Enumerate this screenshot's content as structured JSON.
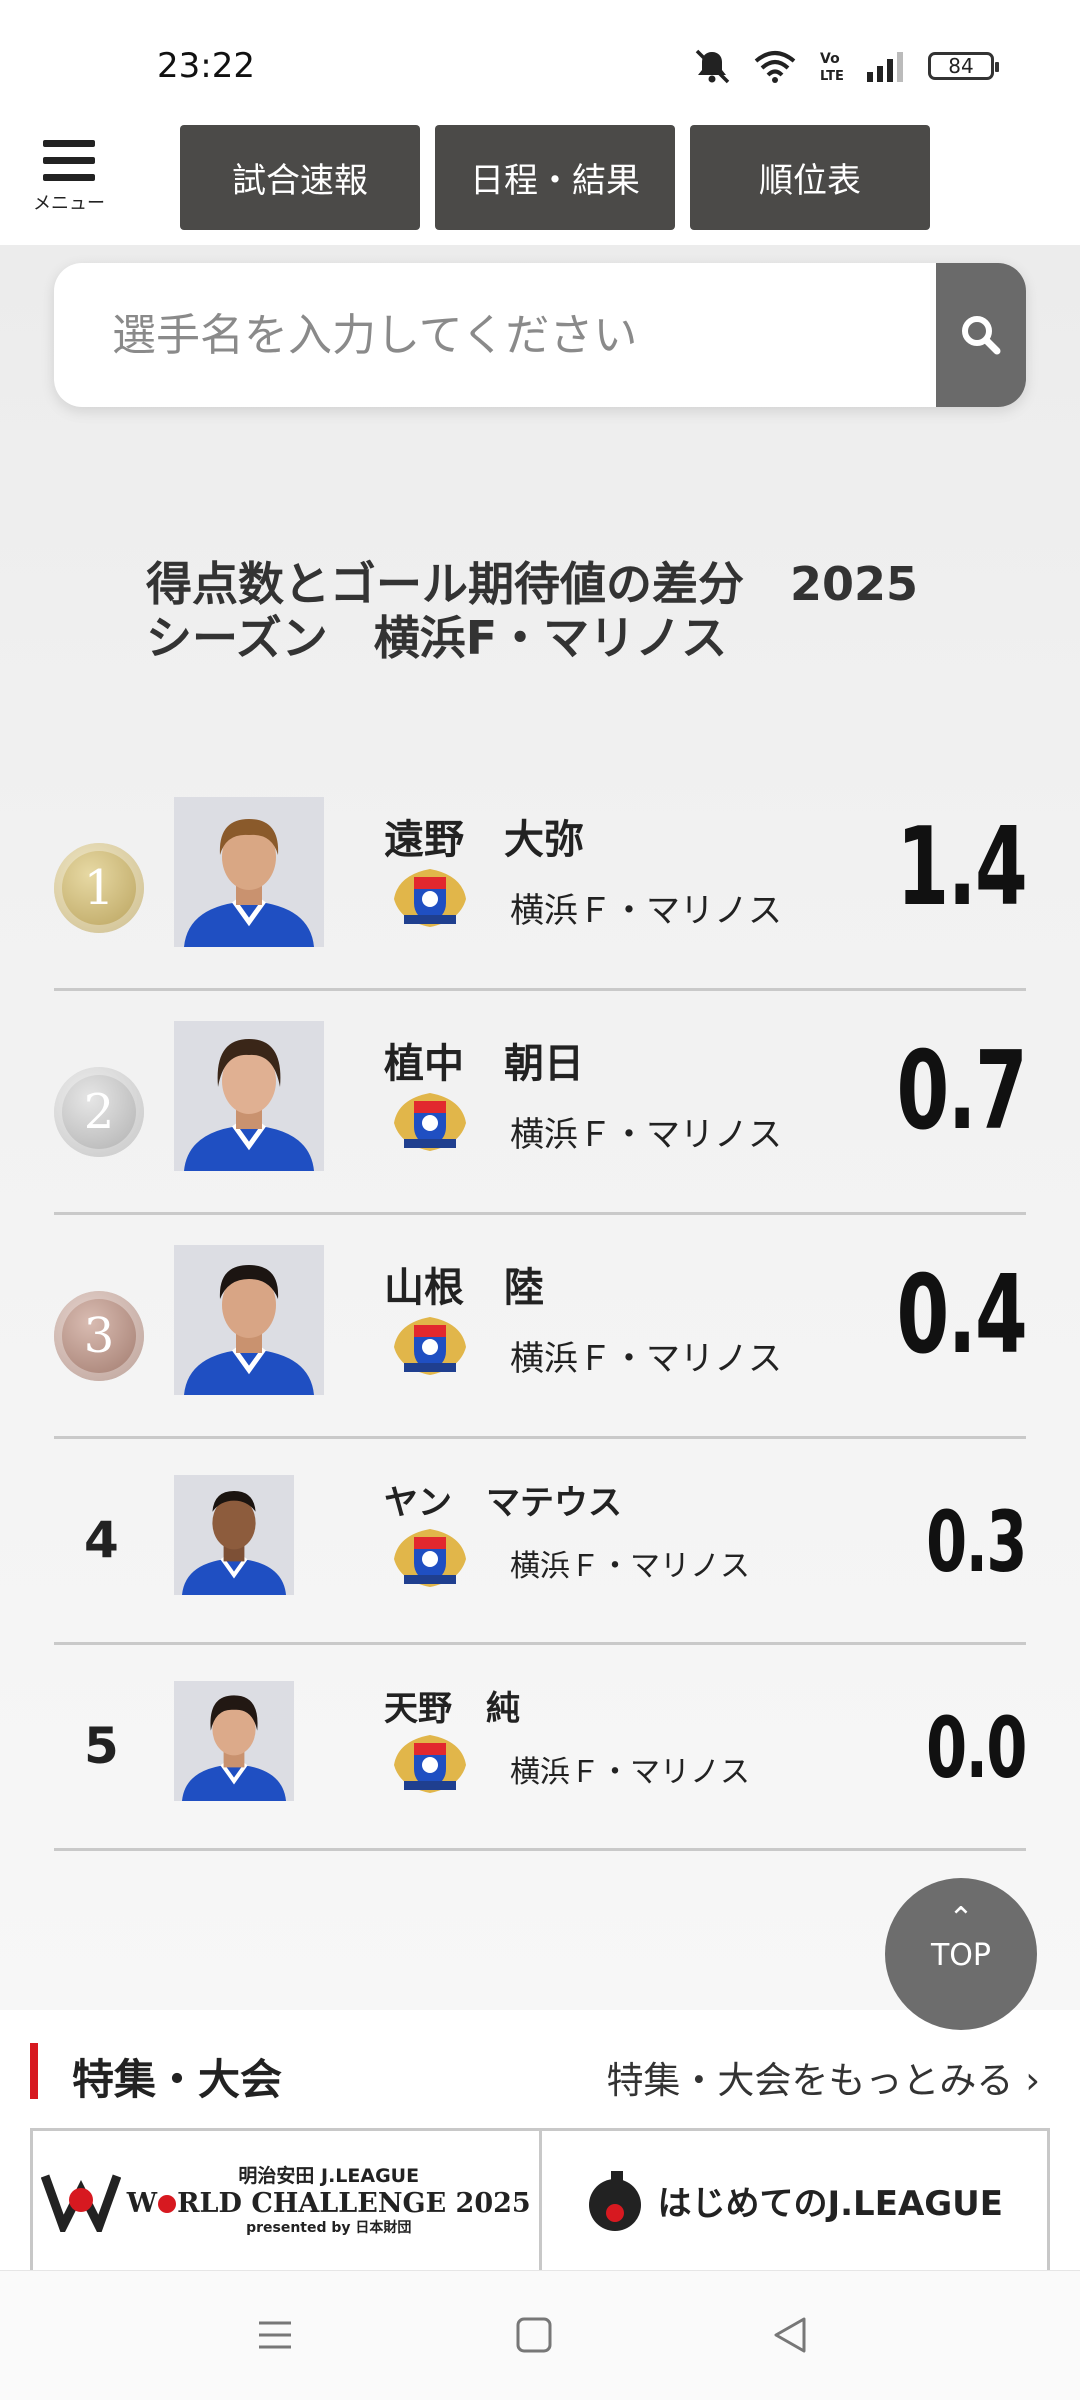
{
  "status_bar": {
    "time": "23:22",
    "battery": "84",
    "icons": [
      "mute-icon",
      "wifi-icon",
      "volte-icon",
      "signal-icon",
      "battery-icon"
    ]
  },
  "header": {
    "menu_label": "メニュー",
    "nav": [
      "試合速報",
      "日程・結果",
      "順位表"
    ]
  },
  "search": {
    "placeholder": "選手名を入力してください"
  },
  "ranking": {
    "title_line1": "得点数とゴール期待値の差分　2025",
    "title_line2": "シーズン　横浜F・マリノス",
    "players": [
      {
        "rank": "1",
        "name": "遠野　大弥",
        "team": "横浜Ｆ・マリノス",
        "value": "1.4"
      },
      {
        "rank": "2",
        "name": "植中　朝日",
        "team": "横浜Ｆ・マリノス",
        "value": "0.7"
      },
      {
        "rank": "3",
        "name": "山根　陸",
        "team": "横浜Ｆ・マリノス",
        "value": "0.4"
      },
      {
        "rank": "4",
        "name": "ヤン　マテウス",
        "team": "横浜Ｆ・マリノス",
        "value": "0.3"
      },
      {
        "rank": "5",
        "name": "天野　純",
        "team": "横浜Ｆ・マリノス",
        "value": "0.0"
      }
    ]
  },
  "top_button": {
    "label": "TOP"
  },
  "feature": {
    "title": "特集・大会",
    "link": "特集・大会をもっとみる ›",
    "banner1": {
      "line1": "明治安田 J.LEAGUE",
      "line2a": "W",
      "line2b": "RLD CHALLENGE 2025",
      "line3": "presented by 日本財団"
    },
    "banner2": {
      "text": "はじめてのJ.LEAGUE"
    }
  },
  "colors": {
    "nav_button": "#4b4a48",
    "accent_red": "#d71920",
    "gold": "#c9b36b",
    "silver": "#bdbdbd",
    "bronze": "#b08a7d",
    "kit_blue": "#1f4fc2"
  }
}
